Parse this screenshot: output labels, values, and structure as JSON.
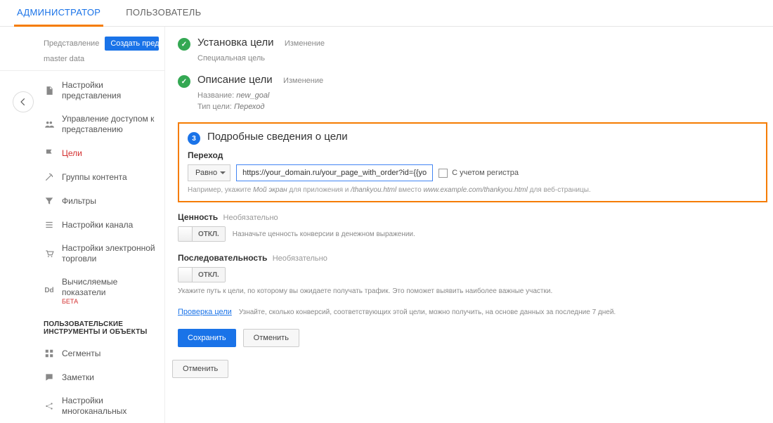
{
  "tabs": {
    "admin": "АДМИНИСТРАТОР",
    "user": "ПОЛЬЗОВАТЕЛЬ"
  },
  "sidebar": {
    "view_label": "Представление",
    "create_view_btn": "Создать представл...",
    "view_name": "master data",
    "items": [
      {
        "label": "Настройки представления"
      },
      {
        "label": "Управление доступом к представлению"
      },
      {
        "label": "Цели"
      },
      {
        "label": "Группы контента"
      },
      {
        "label": "Фильтры"
      },
      {
        "label": "Настройки канала"
      },
      {
        "label": "Настройки электронной торговли"
      },
      {
        "label": "Вычисляемые показатели",
        "beta": "БЕТА"
      }
    ],
    "section_title": "ПОЛЬЗОВАТЕЛЬСКИЕ ИНСТРУМЕНТЫ И ОБЪЕКТЫ",
    "tools": [
      {
        "label": "Сегменты"
      },
      {
        "label": "Заметки"
      },
      {
        "label": "Настройки многоканальных"
      }
    ]
  },
  "steps": {
    "s1": {
      "title": "Установка цели",
      "edit": "Изменение",
      "sub": "Специальная цель"
    },
    "s2": {
      "title": "Описание цели",
      "edit": "Изменение",
      "name_lbl": "Название:",
      "name_val": "new_goal",
      "type_lbl": "Тип цели:",
      "type_val": "Переход"
    },
    "s3": {
      "num": "3",
      "title": "Подробные сведения о цели"
    }
  },
  "dest": {
    "label": "Переход",
    "match": "Равно",
    "url": "https://your_domain.ru/your_page_with_order?id={{your_id}}",
    "case_label": "С учетом регистра",
    "hint_pre": "Например, укажите ",
    "hint_em1": "Мой экран",
    "hint_mid1": " для приложения и ",
    "hint_em2": "/thankyou.html",
    "hint_mid2": " вместо ",
    "hint_em3": "www.example.com/thankyou.html",
    "hint_post": " для веб-страницы."
  },
  "value": {
    "label": "Ценность",
    "opt": "Необязательно",
    "toggle": "ОТКЛ.",
    "desc": "Назначьте ценность конверсии в денежном выражении."
  },
  "funnel": {
    "label": "Последовательность",
    "opt": "Необязательно",
    "toggle": "ОТКЛ.",
    "desc": "Укажите путь к цели, по которому вы ожидаете получать трафик. Это поможет выявить наиболее важные участки."
  },
  "verify": {
    "link": "Проверка цели ",
    "text": "Узнайте, сколько конверсий, соответствующих этой цели, можно получить, на основе данных за последние 7 дней."
  },
  "buttons": {
    "save": "Сохранить",
    "cancel": "Отменить",
    "cancel2": "Отменить"
  }
}
